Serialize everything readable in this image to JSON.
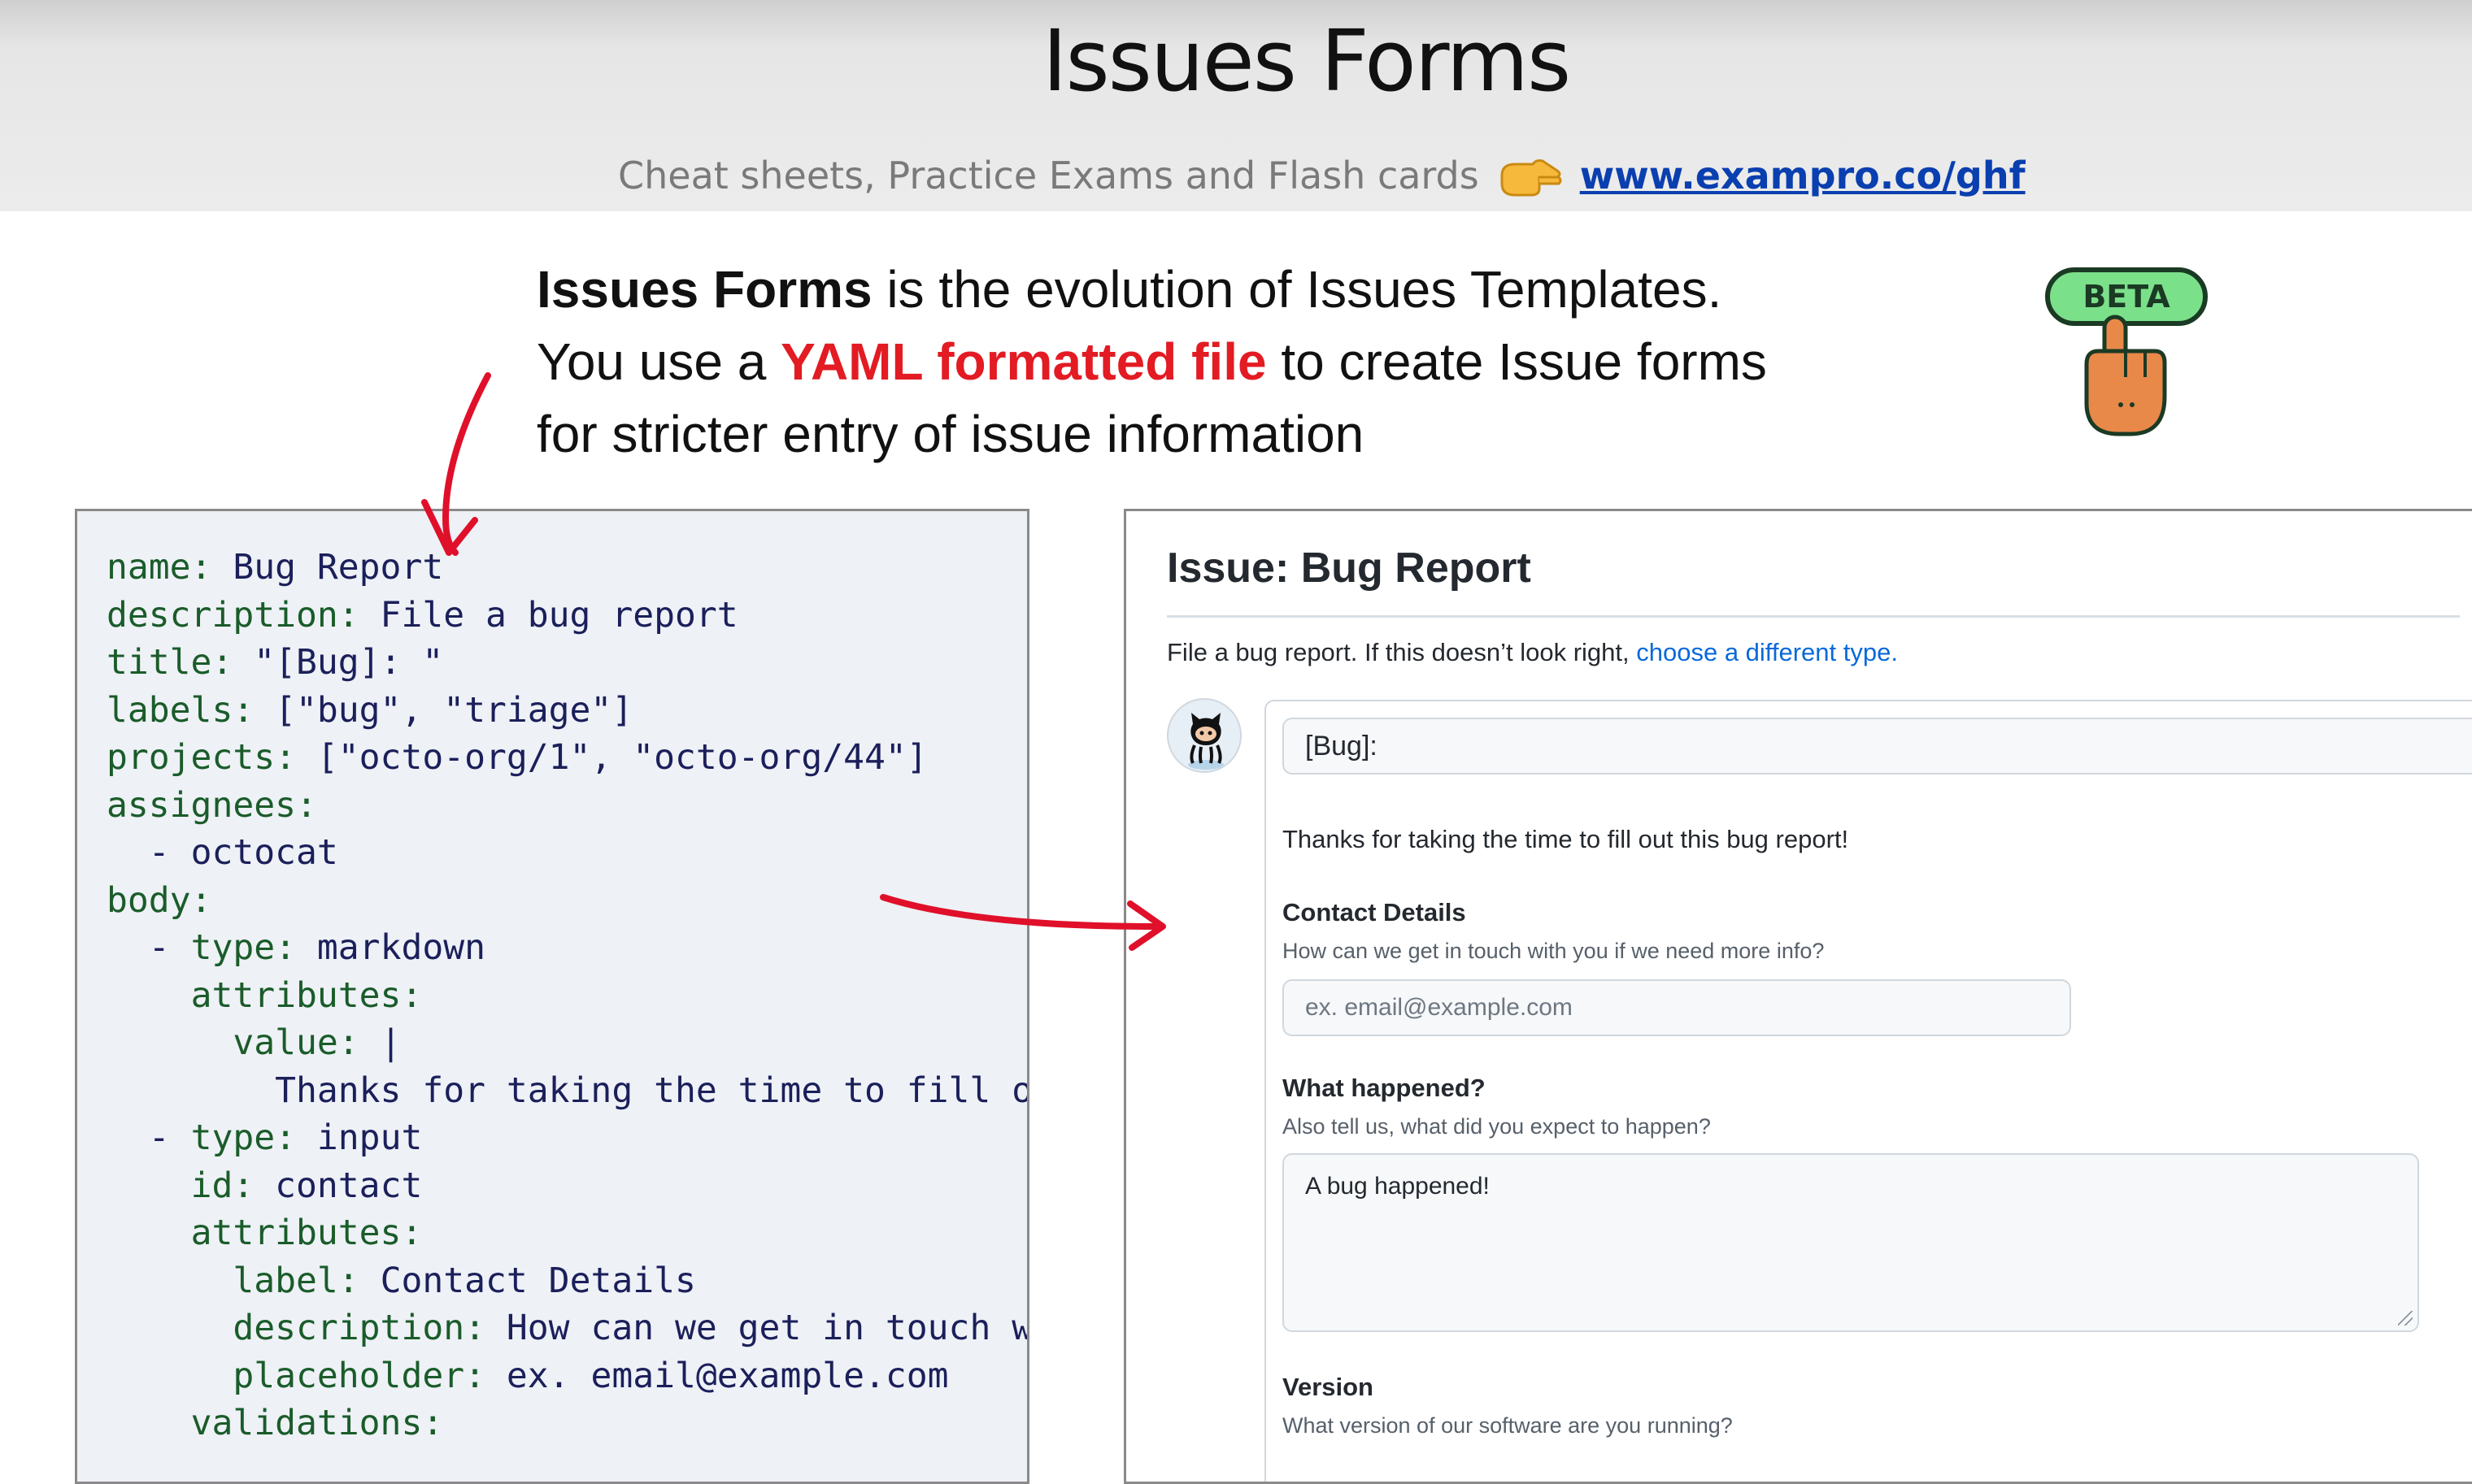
{
  "header": {
    "title": "Issues Forms",
    "promo_text": "Cheat sheets, Practice Exams and Flash cards",
    "promo_icon": "pointing-hand-icon",
    "promo_link": "www.exampro.co/ghf"
  },
  "intro": {
    "line1_bold": "Issues Forms",
    "line1_rest": " is the evolution of Issues Templates.",
    "line2_start": "You use a ",
    "line2_highlight": "YAML formatted file",
    "line2_end": " to create Issue forms",
    "line3": "for stricter entry of issue information"
  },
  "badge": {
    "label": "BETA",
    "icon": "hand-press-icon"
  },
  "colors": {
    "highlight_red": "#e31b23",
    "arrow_red": "#e0102a",
    "link_blue": "#0969da",
    "badge_green": "#7be08a"
  },
  "code": {
    "lines": [
      {
        "indent": "",
        "key": "name:",
        "value": " Bug Report"
      },
      {
        "indent": "",
        "key": "description:",
        "value": " File a bug report"
      },
      {
        "indent": "",
        "key": "title:",
        "value": " \"[Bug]: \""
      },
      {
        "indent": "",
        "key": "labels:",
        "value": " [\"bug\", \"triage\"]"
      },
      {
        "indent": "",
        "key": "projects:",
        "value": " [\"octo-org/1\", \"octo-org/44\"]"
      },
      {
        "indent": "",
        "key": "assignees:",
        "value": ""
      },
      {
        "indent": "  - ",
        "key": "",
        "value": "octocat"
      },
      {
        "indent": "",
        "key": "body:",
        "value": ""
      },
      {
        "indent": "  - ",
        "key": "type:",
        "value": " markdown"
      },
      {
        "indent": "    ",
        "key": "attributes:",
        "value": ""
      },
      {
        "indent": "      ",
        "key": "value:",
        "value": " |"
      },
      {
        "indent": "        ",
        "key": "",
        "value": "Thanks for taking the time to fill out"
      },
      {
        "indent": "  - ",
        "key": "type:",
        "value": " input"
      },
      {
        "indent": "    ",
        "key": "id:",
        "value": " contact"
      },
      {
        "indent": "    ",
        "key": "attributes:",
        "value": ""
      },
      {
        "indent": "      ",
        "key": "label:",
        "value": " Contact Details"
      },
      {
        "indent": "      ",
        "key": "description:",
        "value": " How can we get in touch with"
      },
      {
        "indent": "      ",
        "key": "placeholder:",
        "value": " ex. email@example.com"
      },
      {
        "indent": "    ",
        "key": "validations:",
        "value": ""
      }
    ]
  },
  "form": {
    "title": "Issue: Bug Report",
    "desc_text": "File a bug report. If this doesn’t look right, ",
    "desc_link": "choose a different type.",
    "avatar_icon": "octocat-icon",
    "title_value": "[Bug]:",
    "intro_message": "Thanks for taking the time to fill out this bug report!",
    "contact": {
      "label": "Contact Details",
      "help": "How can we get in touch with you if we need more info?",
      "placeholder": "ex. email@example.com"
    },
    "what_happened": {
      "label": "What happened?",
      "help": "Also tell us, what did you expect to happen?",
      "value": "A bug happened!"
    },
    "version": {
      "label": "Version",
      "help": "What version of our software are you running?"
    }
  }
}
